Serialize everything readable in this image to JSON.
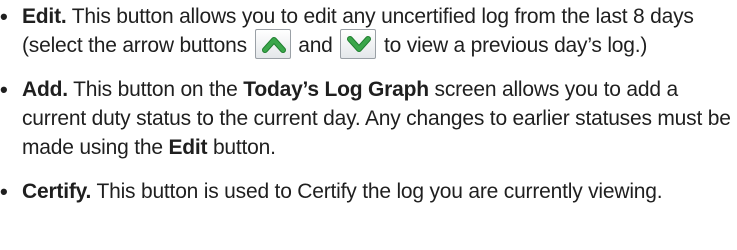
{
  "bullet_char": "•",
  "colors": {
    "text": "#1f1f1f",
    "arrow_green": "#3aa64a",
    "arrow_green_dark": "#1e7d2e",
    "button_border": "#9aa0a6"
  },
  "items": [
    {
      "term": "Edit.",
      "text_1": " This button allows you to edit any uncertified log from the last 8 days (select the arrow buttons ",
      "icon_up": "chevron-up-icon",
      "text_2": " and ",
      "icon_down": "chevron-down-icon",
      "text_3": " to view a previous day’s log.)"
    },
    {
      "term": "Add.",
      "text_1": " This button on the ",
      "bold_1": "Today’s Log Graph",
      "text_2": " screen allows you to add a current duty status to the current day. Any changes to earlier statuses must be made using the ",
      "bold_2": "Edit",
      "text_3": " button."
    },
    {
      "term": "Certify.",
      "text_1": " This button is used to Certify the log you are currently viewing."
    }
  ]
}
